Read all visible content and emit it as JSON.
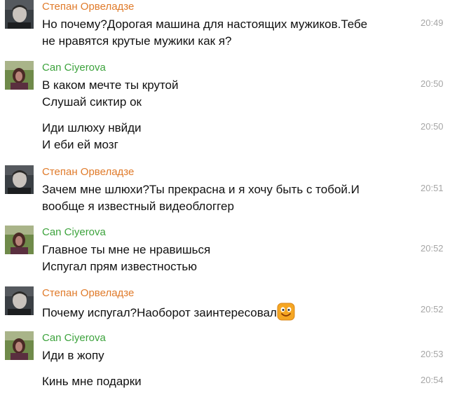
{
  "colors": {
    "stepan_name": "#e07b2b",
    "can_name": "#3da33d",
    "message_text": "#111111",
    "timestamp": "#a6a6a6"
  },
  "messages": [
    {
      "author": "Степан Орвеладзе",
      "text": [
        "Но почему?Дорогая машина для настоящих мужиков.Тебе",
        "не нравятся крутые мужики как я?"
      ],
      "time": "20:49"
    },
    {
      "author": "Can Ciyerova",
      "text": [
        "В каком мечте ты крутой",
        "Слушай сиктир ок"
      ],
      "time": "20:50"
    },
    {
      "text": [
        "Иди шлюху нвйди",
        "И еби ей мозг"
      ],
      "time": "20:50"
    },
    {
      "author": "Степан Орвеладзе",
      "text": [
        "Зачем мне шлюхи?Ты прекрасна и я хочу быть с тобой.И",
        "вообще я известный видеоблоггер"
      ],
      "time": "20:51"
    },
    {
      "author": "Can Ciyerova",
      "text": [
        "Главное ты мне не нравишься",
        "Испугал прям известностью"
      ],
      "time": "20:52"
    },
    {
      "author": "Степан Орвеладзе",
      "text": [
        "Почему испугал?Наоборот заинтересовал"
      ],
      "emoji": "smile-emoji-icon",
      "time": "20:52"
    },
    {
      "author": "Can Ciyerova",
      "text": [
        "Иди в жопу"
      ],
      "time": "20:53"
    },
    {
      "text": [
        "Кинь мне подарки"
      ],
      "time": "20:54"
    }
  ]
}
